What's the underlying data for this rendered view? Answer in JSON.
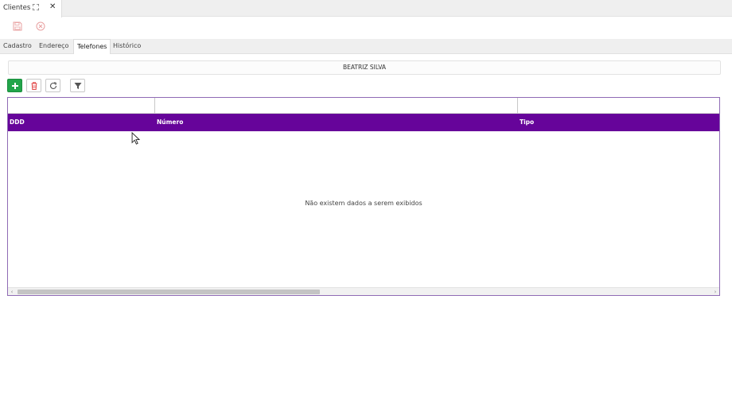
{
  "window_tab": {
    "title": "Clientes"
  },
  "subtabs": [
    {
      "label": "Cadastro"
    },
    {
      "label": "Endereço"
    },
    {
      "label": "Telefones"
    },
    {
      "label": "Histórico"
    }
  ],
  "client": {
    "name": "BEATRIZ SILVA"
  },
  "grid": {
    "columns": [
      {
        "label": "DDD"
      },
      {
        "label": "Número"
      },
      {
        "label": "Tipo"
      }
    ],
    "empty_message": "Não existem dados a serem exibidos"
  },
  "colors": {
    "header": "#66049a",
    "add_button": "#22a54a",
    "danger": "#e24a4a"
  }
}
